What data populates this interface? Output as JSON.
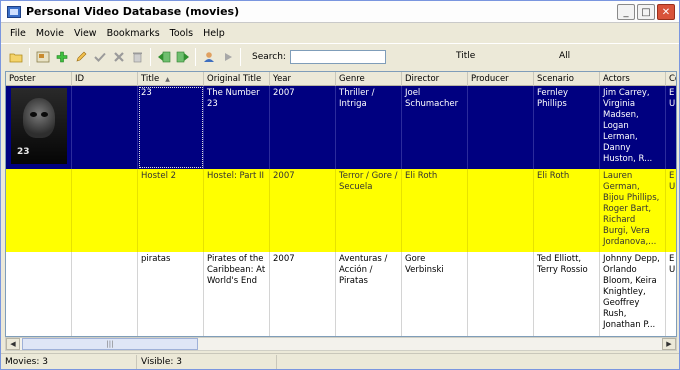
{
  "window": {
    "title": "Personal Video Database (movies)"
  },
  "window_buttons": {
    "minimize": "_",
    "maximize": "□",
    "close": "✕"
  },
  "menu": [
    "File",
    "Movie",
    "View",
    "Bookmarks",
    "Tools",
    "Help"
  ],
  "toolbar": {
    "icons": [
      "open-folder-icon",
      "panel-icon",
      "add-icon",
      "edit-pencil-icon",
      "check-icon",
      "delete-icon",
      "trash-icon",
      "import-icon",
      "export-icon",
      "person-icon",
      "play-icon"
    ],
    "search_label": "Search:",
    "search_value": "",
    "search_field": "Title",
    "search_scope": "All"
  },
  "columns": [
    "Poster",
    "ID",
    "Title",
    "Original Title",
    "Year",
    "Genre",
    "Director",
    "Producer",
    "Scenario",
    "Actors",
    "Co"
  ],
  "rows": [
    {
      "poster_label": "23",
      "id": "",
      "title": "23",
      "original_title": "The Number 23",
      "year": "2007",
      "genre": "Thriller / Intriga",
      "director": "Joel Schumacher",
      "producer": "",
      "scenario": "Fernley Phillips",
      "actors": "Jim Carrey, Virginia Madsen, Logan Lerman, Danny Huston,  R...",
      "country": "E U"
    },
    {
      "id": "",
      "title": "Hostel 2",
      "original_title": "Hostel: Part II",
      "year": "2007",
      "genre": "Terror / Gore / Secuela",
      "director": "Eli Roth",
      "producer": "",
      "scenario": "Eli Roth",
      "actors": "Lauren German, Bijou Phillips, Roger Bart, Richard Burgi,  Vera Jordanova,...",
      "country": "E U"
    },
    {
      "id": "",
      "title": "piratas",
      "original_title": "Pirates of the Caribbean: At World's End",
      "year": "2007",
      "genre": "Aventuras / Acción / Piratas",
      "director": "Gore Verbinski",
      "producer": "",
      "scenario": "Ted Elliott, Terry Rossio",
      "actors": "Johnny Depp,  Orlando Bloom,  Keira Knightley, Geoffrey Rush, Jonathan P...",
      "country": "E U"
    }
  ],
  "scrollbar": {
    "thumb_grip": "|||",
    "left_arrow": "◀",
    "right_arrow": "▶"
  },
  "status": {
    "movies": "Movies: 3",
    "visible": "Visible: 3"
  },
  "colors": {
    "selected_row": "#000080",
    "highlight_row": "#ffff00",
    "window_bg": "#ece9d8"
  }
}
